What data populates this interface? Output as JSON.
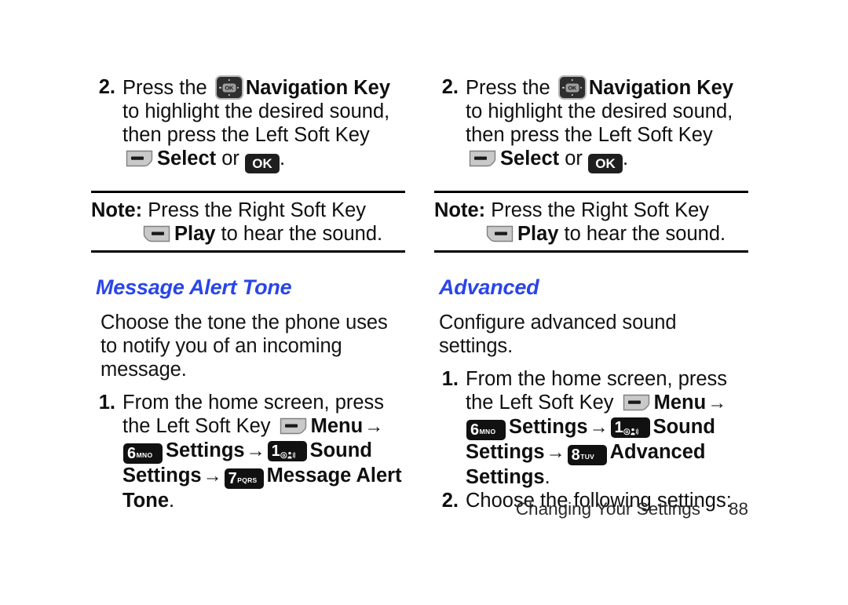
{
  "document": {
    "type": "user-manual-page",
    "heading_color": "#2a45e8",
    "footer": {
      "chapter": "Changing Your Settings",
      "page_number": "88"
    }
  },
  "icons": {
    "navigation_key": "navigation-key-icon",
    "left_soft_key": "left-soft-key-icon",
    "right_soft_key": "right-soft-key-icon",
    "ok_key": "OK",
    "arrow": "→"
  },
  "left_column": {
    "step": {
      "number": "2.",
      "text_1": "Press the ",
      "bold_1": "Navigation Key",
      "text_2": " to highlight the desired sound, then press the Left Soft Key ",
      "bold_2": "Select",
      "text_3": " or ",
      "text_4": "."
    },
    "note": {
      "label": "Note:",
      "text_1": " Press the Right Soft Key ",
      "bold_1": "Play",
      "text_2": " to hear the sound."
    },
    "section": {
      "heading": "Message Alert Tone",
      "intro": "Choose the tone the phone uses to notify you of an incoming message.",
      "step": {
        "number": "1.",
        "text_1": "From the home screen, press the Left Soft Key ",
        "bold_1": "Menu",
        "keys": [
          {
            "digit": "6",
            "letters": "MNO",
            "label": "Settings"
          },
          {
            "digit": "1",
            "letters": "@ ●)",
            "label": "Sound Settings"
          },
          {
            "digit": "7",
            "letters": "PQRS",
            "label": "Message Alert Tone"
          }
        ],
        "terminator": "."
      }
    }
  },
  "right_column": {
    "step": {
      "number": "2.",
      "text_1": "Press the ",
      "bold_1": "Navigation Key",
      "text_2": " to highlight the desired sound, then press the Left Soft Key ",
      "bold_2": "Select",
      "text_3": " or ",
      "text_4": "."
    },
    "note": {
      "label": "Note:",
      "text_1": " Press the Right Soft Key ",
      "bold_1": "Play",
      "text_2": " to hear the sound."
    },
    "section": {
      "heading": "Advanced",
      "intro": "Configure advanced sound settings.",
      "step1": {
        "number": "1.",
        "text_1": "From the home screen, press the Left Soft Key ",
        "bold_1": "Menu",
        "keys": [
          {
            "digit": "6",
            "letters": "MNO",
            "label": "Settings"
          },
          {
            "digit": "1",
            "letters": "@ ●)",
            "label": "Sound Settings"
          },
          {
            "digit": "8",
            "letters": "TUV",
            "label": "Advanced Settings"
          }
        ],
        "terminator": "."
      },
      "step2": {
        "number": "2.",
        "text": "Choose the following settings:"
      }
    }
  }
}
